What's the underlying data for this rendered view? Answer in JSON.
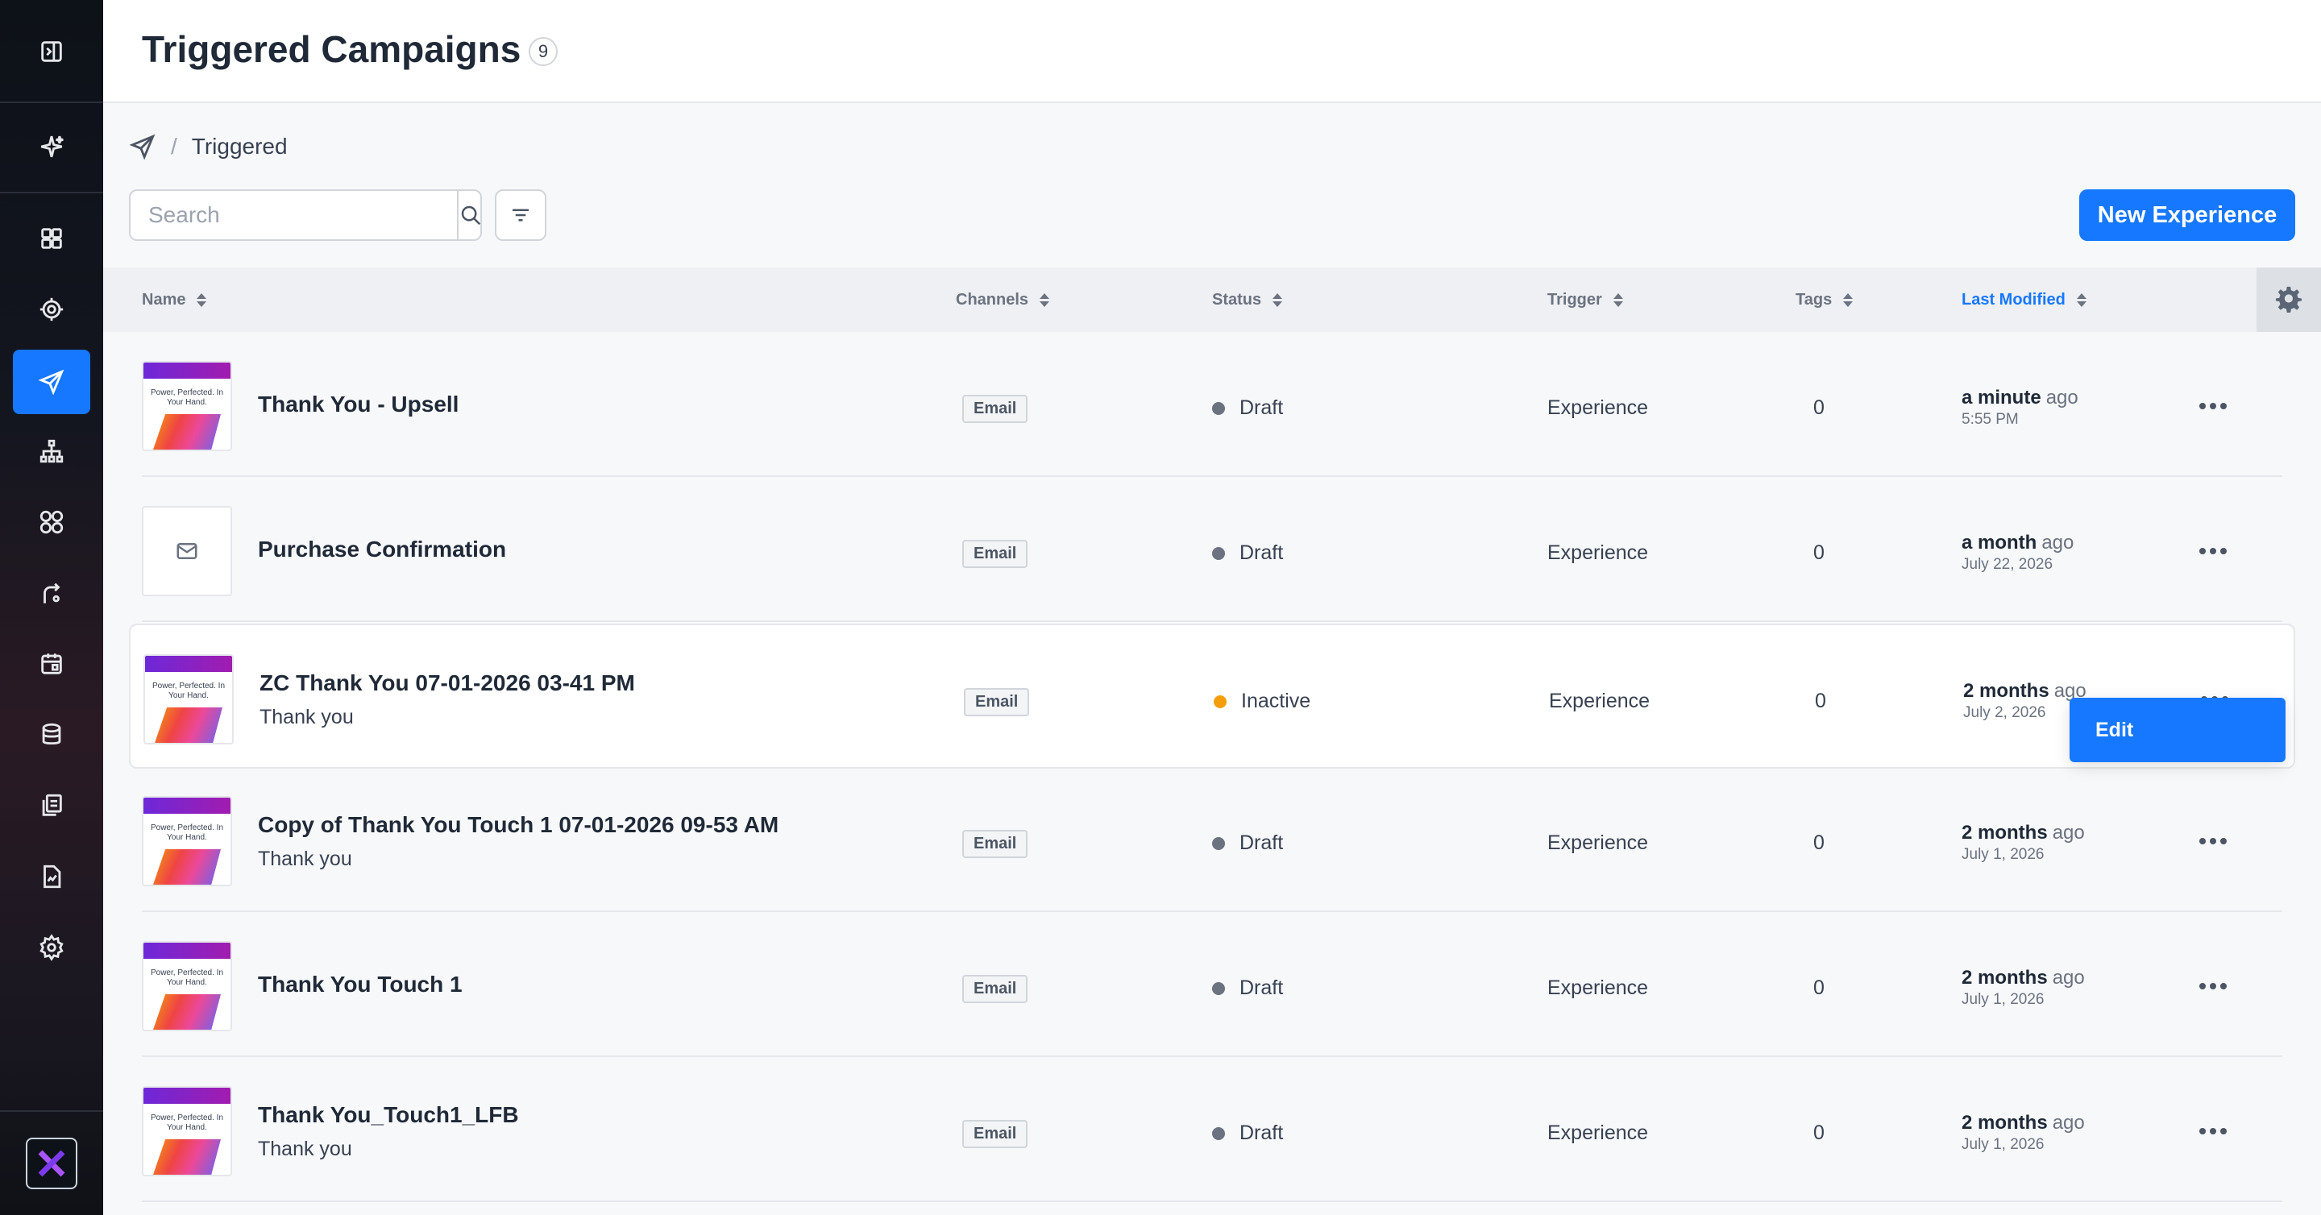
{
  "header": {
    "title": "Triggered Campaigns",
    "count": "9"
  },
  "breadcrumb": {
    "current": "Triggered"
  },
  "toolbar": {
    "search_placeholder": "Search",
    "new_button": "New Experience"
  },
  "columns": {
    "name": "Name",
    "channels": "Channels",
    "status": "Status",
    "trigger": "Trigger",
    "tags": "Tags",
    "last_modified": "Last Modified"
  },
  "thumb_text": "Power, Perfected. In Your Hand.",
  "rows": [
    {
      "name": "Thank You - Upsell",
      "sub": "",
      "channel": "Email",
      "status": "Draft",
      "trigger": "Experience",
      "tags": "0",
      "rel": "a minute",
      "ago": "ago",
      "abs": "5:55 PM"
    },
    {
      "name": "Purchase Confirmation",
      "sub": "",
      "channel": "Email",
      "status": "Draft",
      "trigger": "Experience",
      "tags": "0",
      "rel": "a month",
      "ago": "ago",
      "abs": "July 22, 2026"
    },
    {
      "name": "ZC Thank You 07-01-2026 03-41 PM",
      "sub": "Thank you",
      "channel": "Email",
      "status": "Inactive",
      "trigger": "Experience",
      "tags": "0",
      "rel": "2 months",
      "ago": "ago",
      "abs": "July 2, 2026"
    },
    {
      "name": "Copy of Thank You Touch 1 07-01-2026 09-53 AM",
      "sub": "Thank you",
      "channel": "Email",
      "status": "Draft",
      "trigger": "Experience",
      "tags": "0",
      "rel": "2 months",
      "ago": "ago",
      "abs": "July 1, 2026"
    },
    {
      "name": "Thank You Touch 1",
      "sub": "",
      "channel": "Email",
      "status": "Draft",
      "trigger": "Experience",
      "tags": "0",
      "rel": "2 months",
      "ago": "ago",
      "abs": "July 1, 2026"
    },
    {
      "name": "Thank You_Touch1_LFB",
      "sub": "Thank you",
      "channel": "Email",
      "status": "Draft",
      "trigger": "Experience",
      "tags": "0",
      "rel": "2 months",
      "ago": "ago",
      "abs": "July 1, 2026"
    }
  ],
  "popup": {
    "edit": "Edit"
  },
  "colors": {
    "accent": "#1677ff",
    "draft_dot": "#6b7280",
    "inactive_dot": "#f59e0b"
  }
}
